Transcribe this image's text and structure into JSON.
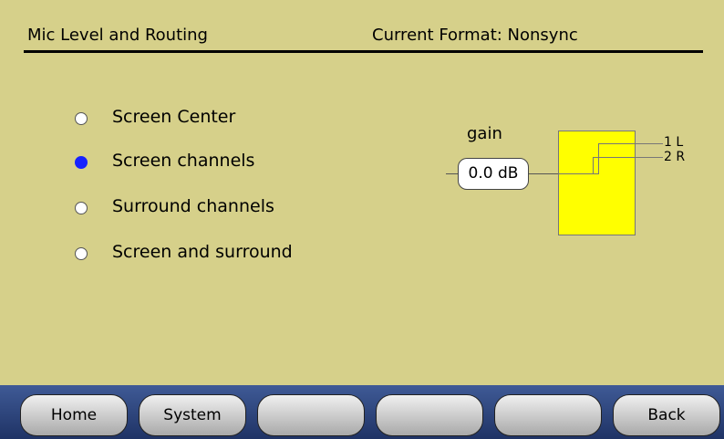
{
  "header": {
    "title": "Mic Level and Routing",
    "format": "Current Format: Nonsync"
  },
  "routing_options": [
    {
      "label": "Screen Center",
      "selected": false
    },
    {
      "label": "Screen channels",
      "selected": true
    },
    {
      "label": "Surround channels",
      "selected": false
    },
    {
      "label": "Screen and surround",
      "selected": false
    }
  ],
  "diagram": {
    "gain_label": "gain",
    "gain_value": "0.0 dB",
    "outputs": [
      "1 L",
      "2 R"
    ]
  },
  "buttons": [
    "Home",
    "System",
    "",
    "",
    "",
    "Back"
  ],
  "colors": {
    "background": "#d6d08a",
    "selected_radio": "#1622ff",
    "router_box": "#ffff00",
    "bottom_bar": "#2b4178"
  }
}
